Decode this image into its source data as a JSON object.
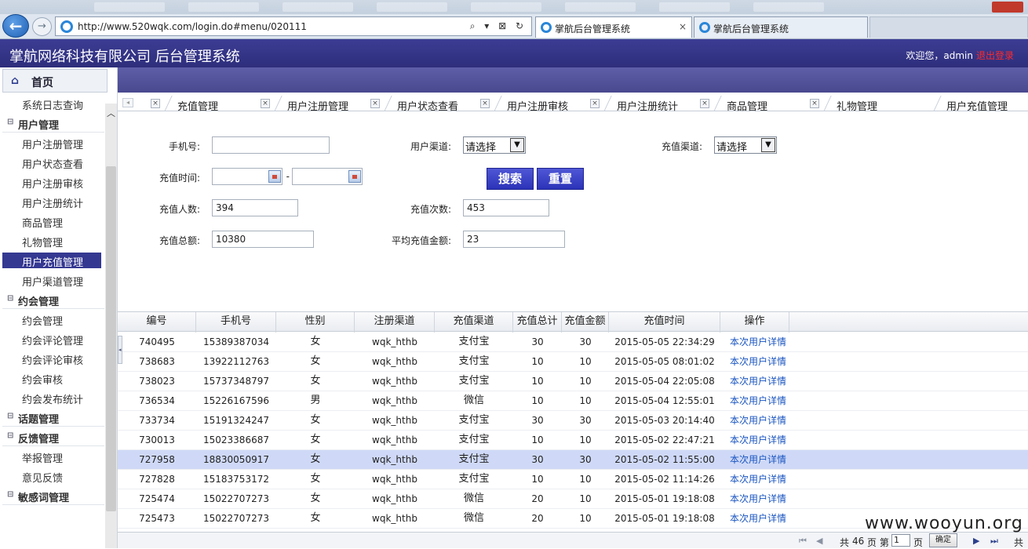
{
  "browser": {
    "url": "http://www.520wqk.com/login.do#menu/020111",
    "tabs": [
      {
        "title": "掌航后台管理系统",
        "active": true
      },
      {
        "title": "掌航后台管理系统",
        "active": false
      }
    ],
    "close_glyph": "×"
  },
  "header": {
    "title": "掌航网络科技有限公司 后台管理系统",
    "welcome": "欢迎您，admin",
    "logout": "退出登录"
  },
  "sidebar": {
    "home": "首页",
    "items": [
      {
        "label": "系统日志查询",
        "type": "item"
      },
      {
        "label": "用户管理",
        "type": "group"
      },
      {
        "label": "用户注册管理",
        "type": "item"
      },
      {
        "label": "用户状态查看",
        "type": "item"
      },
      {
        "label": "用户注册审核",
        "type": "item"
      },
      {
        "label": "用户注册统计",
        "type": "item"
      },
      {
        "label": "商品管理",
        "type": "item"
      },
      {
        "label": "礼物管理",
        "type": "item"
      },
      {
        "label": "用户充值管理",
        "type": "item",
        "active": true
      },
      {
        "label": "用户渠道管理",
        "type": "item"
      },
      {
        "label": "约会管理",
        "type": "group"
      },
      {
        "label": "约会管理",
        "type": "item"
      },
      {
        "label": "约会评论管理",
        "type": "item"
      },
      {
        "label": "约会评论审核",
        "type": "item"
      },
      {
        "label": "约会审核",
        "type": "item"
      },
      {
        "label": "约会发布统计",
        "type": "item"
      },
      {
        "label": "话题管理",
        "type": "group"
      },
      {
        "label": "反馈管理",
        "type": "group"
      },
      {
        "label": "举报管理",
        "type": "item"
      },
      {
        "label": "意见反馈",
        "type": "item"
      },
      {
        "label": "敏感词管理",
        "type": "group"
      }
    ]
  },
  "module_tabs": [
    "充值管理",
    "用户注册管理",
    "用户状态查看",
    "用户注册审核",
    "用户注册统计",
    "商品管理",
    "礼物管理",
    "用户充值管理"
  ],
  "form": {
    "phone_label": "手机号:",
    "phone_value": "",
    "user_channel_label": "用户渠道:",
    "user_channel_value": "请选择",
    "recharge_channel_label": "充值渠道:",
    "recharge_channel_value": "请选择",
    "time_label": "充值时间:",
    "time_sep": "-",
    "search_btn": "搜索",
    "reset_btn": "重置",
    "people_label": "充值人数:",
    "people_value": "394",
    "times_label": "充值次数:",
    "times_value": "453",
    "total_label": "充值总额:",
    "total_value": "10380",
    "avg_label": "平均充值金额:",
    "avg_value": "23"
  },
  "table": {
    "columns": [
      "编号",
      "手机号",
      "性别",
      "注册渠道",
      "充值渠道",
      "充值总计",
      "充值金额",
      "充值时间",
      "操作"
    ],
    "rows": [
      [
        "740495",
        "15389387034",
        "女",
        "wqk_hthb",
        "支付宝",
        "30",
        "30",
        "2015-05-05 22:34:29",
        "本次用户详情"
      ],
      [
        "738683",
        "13922112763",
        "女",
        "wqk_hthb",
        "支付宝",
        "10",
        "10",
        "2015-05-05 08:01:02",
        "本次用户详情"
      ],
      [
        "738023",
        "15737348797",
        "女",
        "wqk_hthb",
        "支付宝",
        "10",
        "10",
        "2015-05-04 22:05:08",
        "本次用户详情"
      ],
      [
        "736534",
        "15226167596",
        "男",
        "wqk_hthb",
        "微信",
        "10",
        "10",
        "2015-05-04 12:55:01",
        "本次用户详情"
      ],
      [
        "733734",
        "15191324247",
        "女",
        "wqk_hthb",
        "支付宝",
        "30",
        "30",
        "2015-05-03 20:14:40",
        "本次用户详情"
      ],
      [
        "730013",
        "15023386687",
        "女",
        "wqk_hthb",
        "支付宝",
        "10",
        "10",
        "2015-05-02 22:47:21",
        "本次用户详情"
      ],
      [
        "727958",
        "18830050917",
        "女",
        "wqk_hthb",
        "支付宝",
        "30",
        "30",
        "2015-05-02 11:55:00",
        "本次用户详情"
      ],
      [
        "727828",
        "15183753172",
        "女",
        "wqk_hthb",
        "支付宝",
        "10",
        "10",
        "2015-05-02 11:14:26",
        "本次用户详情"
      ],
      [
        "725474",
        "15022707273",
        "女",
        "wqk_hthb",
        "微信",
        "20",
        "10",
        "2015-05-01 19:18:08",
        "本次用户详情"
      ],
      [
        "725473",
        "15022707273",
        "女",
        "wqk_hthb",
        "微信",
        "20",
        "10",
        "2015-05-01 19:18:08",
        "本次用户详情"
      ]
    ],
    "selected_row": 6
  },
  "pager": {
    "total_prefix": "共",
    "total_pages": "46",
    "total_suffix": "页 第",
    "current": "1",
    "page_suffix": "页",
    "go": "确定",
    "trailing": "共"
  },
  "watermark": "www.wooyun.org"
}
